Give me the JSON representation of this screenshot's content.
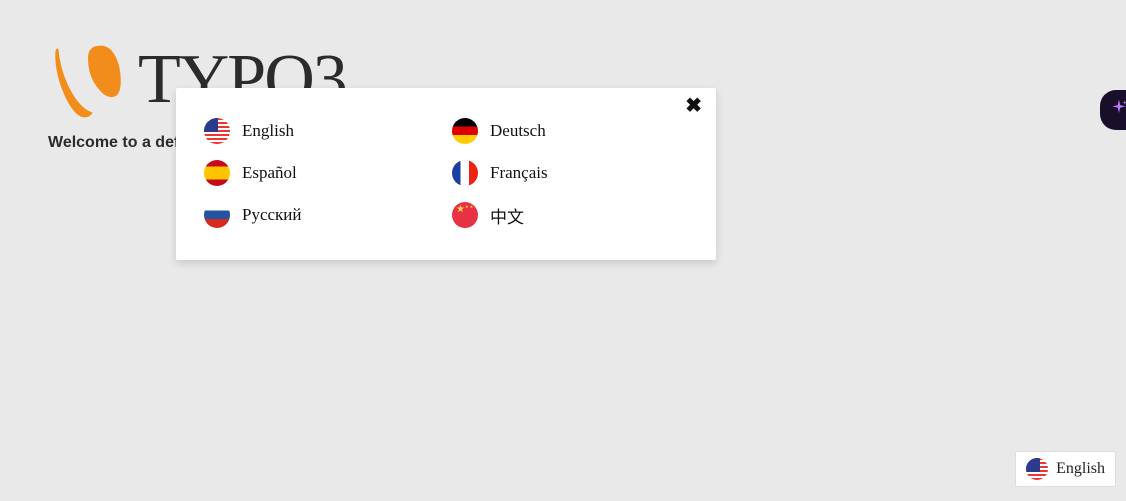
{
  "brand": {
    "name": "TYPO3"
  },
  "welcome_text": "Welcome to a def",
  "popup": {
    "languages": [
      {
        "code": "en",
        "label": "English",
        "flag": "us"
      },
      {
        "code": "de",
        "label": "Deutsch",
        "flag": "de"
      },
      {
        "code": "es",
        "label": "Español",
        "flag": "es"
      },
      {
        "code": "fr",
        "label": "Français",
        "flag": "fr"
      },
      {
        "code": "ru",
        "label": "Русский",
        "flag": "ru"
      },
      {
        "code": "zh",
        "label": "中文",
        "flag": "cn"
      }
    ]
  },
  "badge": {
    "flag": "us",
    "label": "English"
  }
}
